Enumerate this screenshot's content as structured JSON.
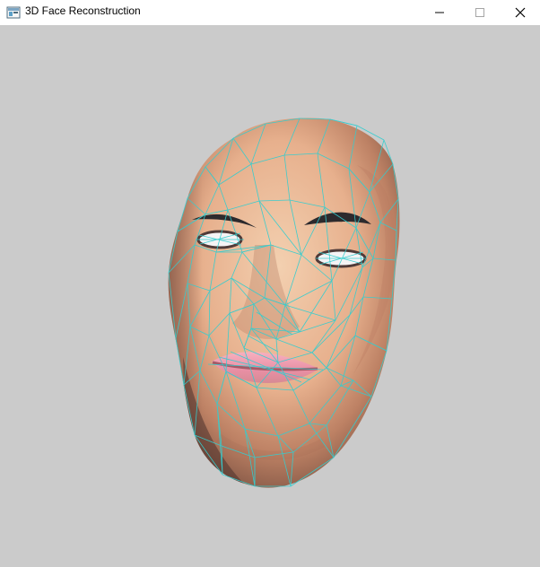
{
  "window": {
    "title": "3D Face Reconstruction",
    "icons": {
      "app": "app-window-icon",
      "minimize": "minimize-icon",
      "maximize": "maximize-icon",
      "close": "close-icon"
    }
  },
  "viewport": {
    "background": "#cbcbcb",
    "mesh_color": "#34cdcf",
    "skin_light": "#efc7a5",
    "skin_mid": "#d7a17f",
    "skin_shadow": "#8a5d49",
    "lip_color": "#f1a0b2",
    "eye_white": "#f5f3f5",
    "brow_color": "#2d2a2d"
  }
}
